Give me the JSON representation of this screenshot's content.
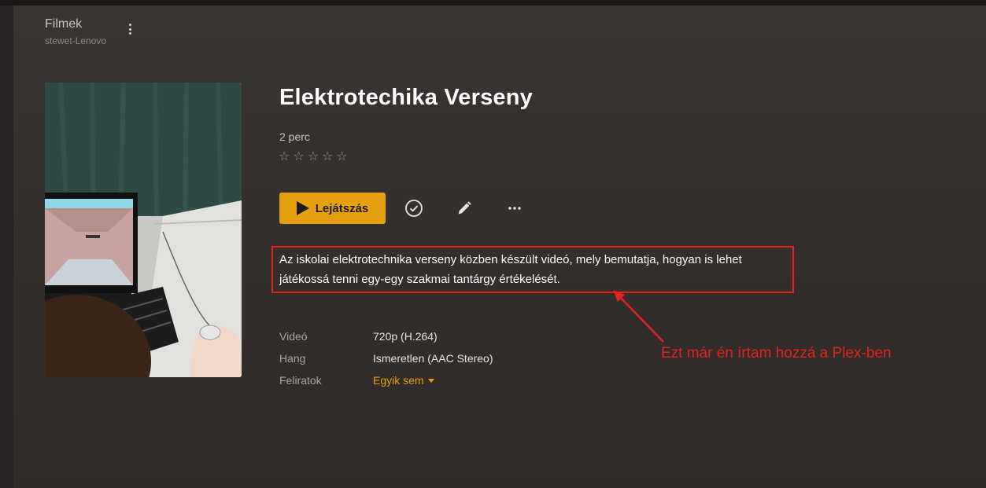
{
  "header": {
    "library_title": "Filmek",
    "server_name": "stewet-Lenovo"
  },
  "item": {
    "title": "Elektrotechika Verseny",
    "duration": "2 perc",
    "rating_stars": 0,
    "summary": "Az iskolai elektrotechnika verseny közben készült videó, mely bemutatja, hogyan is lehet játékossá tenni egy-egy szakmai tantárgy értékelését."
  },
  "actions": {
    "play_label": "Lejátszás",
    "icons": [
      "check-circle-icon",
      "pencil-icon",
      "more-horizontal-icon"
    ]
  },
  "metadata": {
    "video_label": "Videó",
    "video_value": "720p (H.264)",
    "audio_label": "Hang",
    "audio_value": "Ismeretlen (AAC Stereo)",
    "subtitles_label": "Feliratok",
    "subtitles_value": "Egyik sem"
  },
  "annotation": {
    "text": "Ezt már én írtam hozzá a Plex-ben",
    "color": "#e0231f"
  },
  "colors": {
    "accent": "#e5a00d",
    "background": "#352f2d",
    "annotation_red": "#e0231f"
  }
}
